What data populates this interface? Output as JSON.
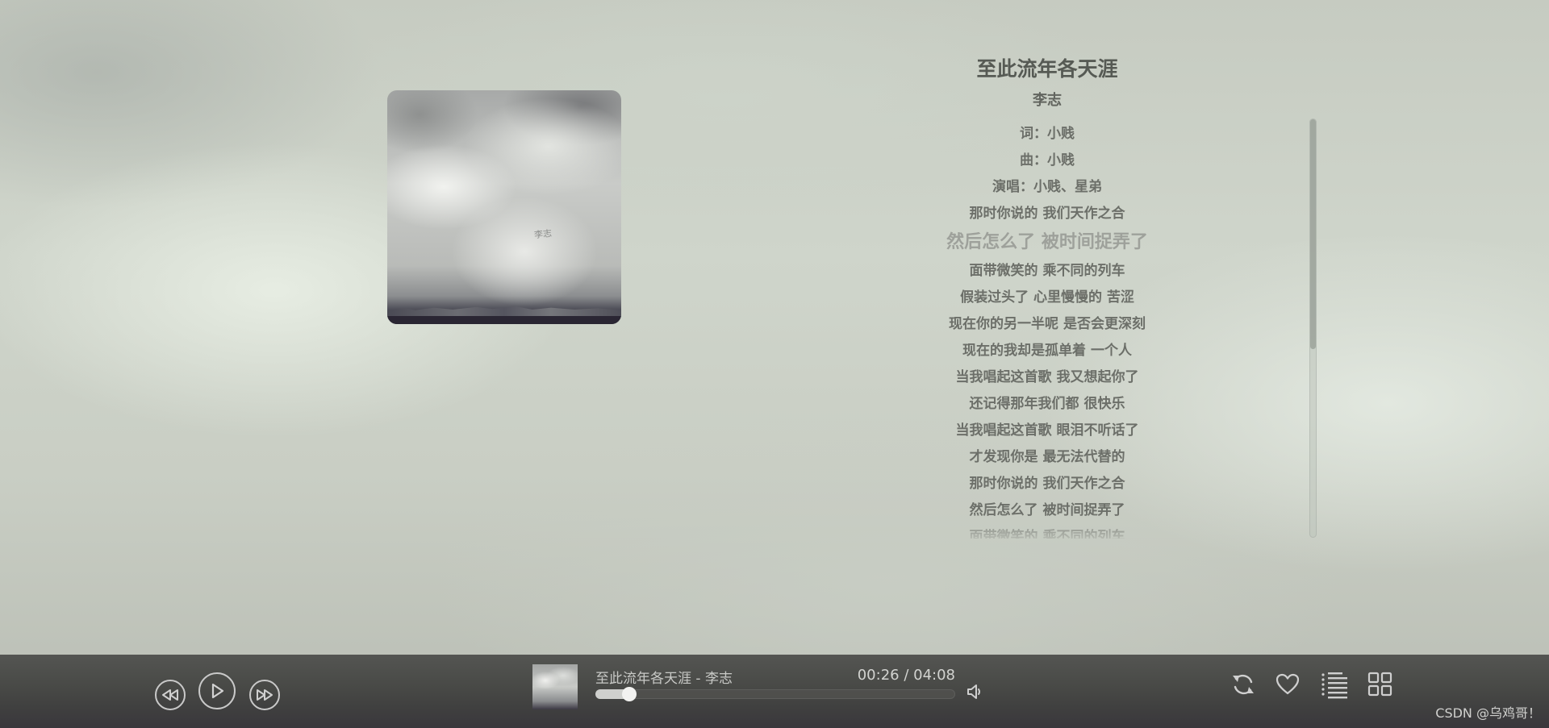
{
  "app": {
    "title": "至此流年各天涯 - 李志"
  },
  "song": {
    "title": "至此流年各天涯",
    "artist": "李志"
  },
  "cover": {
    "signature": "李志"
  },
  "lyrics": [
    "词：小贱",
    "曲：小贱",
    "演唱：小贱、星弟",
    "那时你说的 我们天作之合",
    "然后怎么了 被时间捉弄了",
    "面带微笑的 乘不同的列车",
    "假装过头了 心里慢慢的 苦涩",
    "现在你的另一半呢 是否会更深刻",
    "现在的我却是孤单着 一个人",
    "当我唱起这首歌 我又想起你了",
    "还记得那年我们都 很快乐",
    "当我唱起这首歌 眼泪不听话了",
    "才发现你是 最无法代替的",
    "那时你说的 我们天作之合",
    "然后怎么了 被时间捉弄了",
    "面带微笑的 乘不同的列车"
  ],
  "active_lyric_index": 4,
  "player": {
    "now_playing": "至此流年各天涯 - 李志",
    "current_time": "00:26",
    "total_time": "04:08",
    "time_display": "00:26 / 04:08",
    "progress": 0.0806,
    "icons": {
      "prev": "rewind-icon",
      "play": "play-icon",
      "next": "fast-forward-icon",
      "volume": "volume-icon",
      "loop": "loop-icon",
      "like": "heart-icon",
      "playlist": "playlist-icon",
      "grid": "grid-icon"
    }
  },
  "lyrics_scroll": {
    "thumb_fraction": 0.55,
    "offset": 0
  },
  "watermark": "CSDN @乌鸡哥！",
  "colors": {
    "bar_background": "#484946",
    "lyric_text": "#6c6f69",
    "active_lyric": "#9ea19b"
  }
}
